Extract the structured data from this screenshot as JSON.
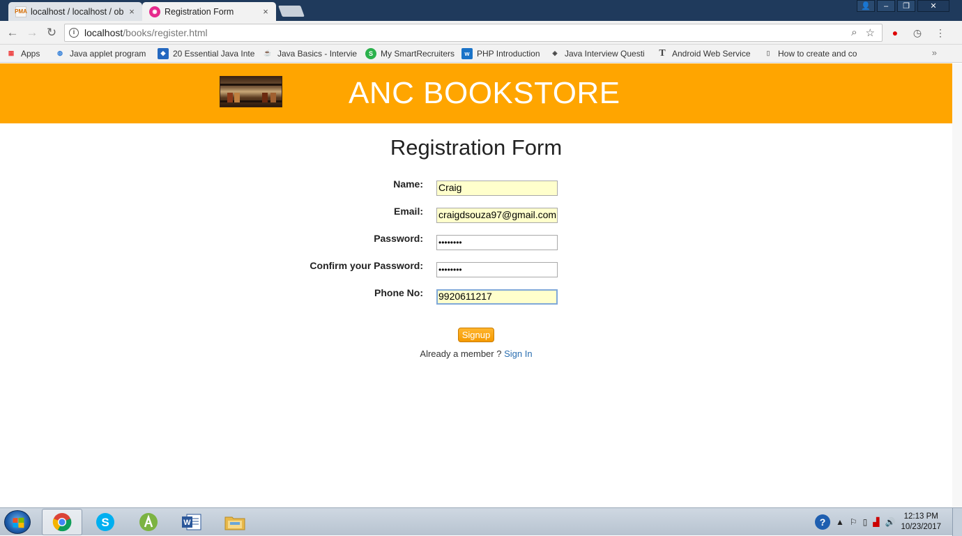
{
  "browser": {
    "tabs": [
      {
        "title": "localhost / localhost / ob",
        "favicon": "phpmyadmin-icon",
        "active": false
      },
      {
        "title": "Registration Form",
        "favicon": "registration-form-icon",
        "active": true
      }
    ],
    "favicon_labels": {
      "pma": "PMA"
    },
    "close_glyph": "×",
    "url_host": "localhost",
    "url_path": "/books/register.html",
    "bookmarks": [
      {
        "label": "Apps",
        "icon": "apps-grid-icon"
      },
      {
        "label": "Java applet program",
        "icon": "globe-icon"
      },
      {
        "label": "20 Essential Java Inte",
        "icon": "toptal-icon"
      },
      {
        "label": "Java Basics - Intervie",
        "icon": "java-icon"
      },
      {
        "label": "My SmartRecruiters",
        "icon": "smartrecruiters-icon"
      },
      {
        "label": "PHP Introduction",
        "icon": "w3schools-icon"
      },
      {
        "label": "Java Interview Questi",
        "icon": "diamond-icon"
      },
      {
        "label": "Android Web Service",
        "icon": "text-t-icon"
      },
      {
        "label": "How to create and co",
        "icon": "document-icon"
      }
    ]
  },
  "site": {
    "title": "ANC BOOKSTORE",
    "header_color": "#ffa500"
  },
  "form": {
    "heading": "Registration Form",
    "fields": {
      "name": {
        "label": "Name:",
        "value": "Craig"
      },
      "email": {
        "label": "Email:",
        "value": "craigdsouza97@gmail.com"
      },
      "password": {
        "label": "Password:",
        "value": "••••••••"
      },
      "confirm_password": {
        "label": "Confirm your Password:",
        "value": "••••••••"
      },
      "phone": {
        "label": "Phone No:",
        "value": "9920611217"
      }
    },
    "submit_label": "Signup",
    "member_text": "Already a member ?",
    "signin_link": "Sign In"
  },
  "taskbar": {
    "apps": [
      "chrome-icon",
      "skype-icon",
      "android-studio-icon",
      "word-icon",
      "file-explorer-icon"
    ],
    "time": "12:13 PM",
    "date": "10/23/2017"
  }
}
